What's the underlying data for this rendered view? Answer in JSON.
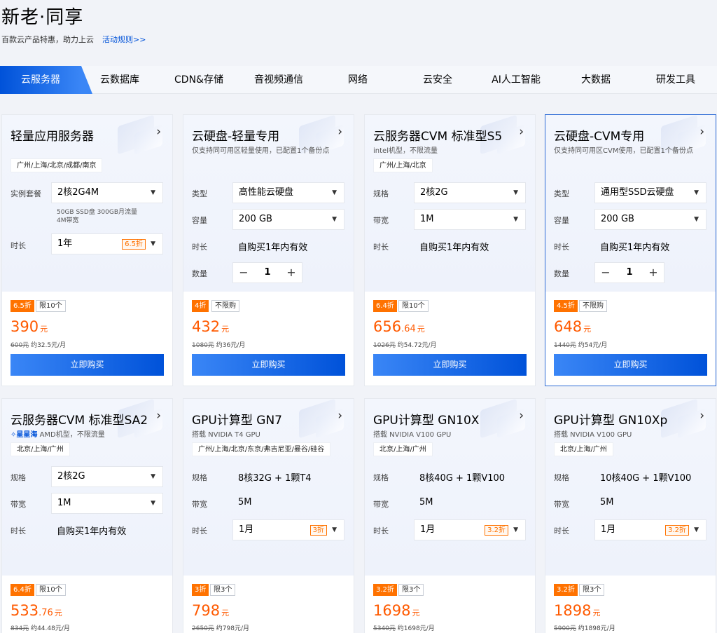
{
  "header": {
    "title": "新老·同享",
    "subtitle": "百款云产品特惠，助力上云",
    "rules_link": "活动规则>>"
  },
  "tabs": [
    "云服务器",
    "云数据库",
    "CDN&存储",
    "音视频通信",
    "网络",
    "云安全",
    "AI人工智能",
    "大数据",
    "研发工具"
  ],
  "cards": [
    {
      "title": "轻量应用服务器",
      "desc": "",
      "region": "广州/上海/北京/成都/南京",
      "label1": "实例套餐",
      "value1": "2核2G4M",
      "note1a": "50GB SSD盘 300GB月流量",
      "note1b": "4M带宽",
      "label2": "时长",
      "value2": "1年",
      "value2_discount": "6.5折",
      "badge": "6.5折",
      "limit": "限10个",
      "price": "390",
      "price_dec": "",
      "unit": "元",
      "orig_price": "600元",
      "per_month": "约32.5元/月",
      "buy": "立即购买"
    },
    {
      "title": "云硬盘-轻量专用",
      "desc": "仅支持同可用区轻量使用，已配置1个备份点",
      "label1": "类型",
      "value1": "高性能云硬盘",
      "label2": "容量",
      "value2": "200 GB",
      "label3": "时长",
      "value3": "自购买1年内有效",
      "label4": "数量",
      "qty": "1",
      "badge": "4折",
      "limit": "不限购",
      "price": "432",
      "price_dec": "",
      "unit": "元",
      "orig_price": "1080元",
      "per_month": "约36元/月",
      "buy": "立即购买"
    },
    {
      "title": "云服务器CVM 标准型S5",
      "desc": "intel机型，不限流量",
      "region": "广州/上海/北京",
      "label1": "规格",
      "value1": "2核2G",
      "label2": "带宽",
      "value2": "1M",
      "label3": "时长",
      "value3": "自购买1年内有效",
      "badge": "6.4折",
      "limit": "限10个",
      "price": "656",
      "price_dec": ".64",
      "unit": "元",
      "orig_price": "1026元",
      "per_month": "约54.72元/月",
      "buy": "立即购买"
    },
    {
      "title": "云硬盘-CVM专用",
      "desc": "仅支持同可用区CVM使用，已配置1个备份点",
      "label1": "类型",
      "value1": "通用型SSD云硬盘",
      "label2": "容量",
      "value2": "200 GB",
      "label3": "时长",
      "value3": "自购买1年内有效",
      "label4": "数量",
      "qty": "1",
      "badge": "4.5折",
      "limit": "不限购",
      "price": "648",
      "price_dec": "",
      "unit": "元",
      "orig_price": "1440元",
      "per_month": "约54元/月",
      "buy": "立即购买"
    },
    {
      "title": "云服务器CVM 标准型SA2",
      "brand": "星星海",
      "desc": "AMD机型，不限流量",
      "region": "北京/上海/广州",
      "label1": "规格",
      "value1": "2核2G",
      "label2": "带宽",
      "value2": "1M",
      "label3": "时长",
      "value3": "自购买1年内有效",
      "badge": "6.4折",
      "limit": "限10个",
      "price": "533",
      "price_dec": ".76",
      "unit": "元",
      "orig_price": "834元",
      "per_month": "约44.48元/月"
    },
    {
      "title": "GPU计算型 GN7",
      "desc": "搭载 NVIDIA T4 GPU",
      "region": "广州/上海/北京/东京/弗吉尼亚/曼谷/硅谷",
      "label1": "规格",
      "value1": "8核32G + 1颗T4",
      "label2": "带宽",
      "value2": "5M",
      "label3": "时长",
      "value3": "1月",
      "value3_discount": "3折",
      "badge": "3折",
      "limit": "限3个",
      "price": "798",
      "price_dec": "",
      "unit": "元",
      "orig_price": "2650元",
      "per_month": "约798元/月"
    },
    {
      "title": "GPU计算型 GN10X",
      "desc": "搭载 NVIDIA V100 GPU",
      "region": "北京/上海/广州",
      "label1": "规格",
      "value1": "8核40G + 1颗V100",
      "label2": "带宽",
      "value2": "5M",
      "label3": "时长",
      "value3": "1月",
      "value3_discount": "3.2折",
      "badge": "3.2折",
      "limit": "限3个",
      "price": "1698",
      "price_dec": "",
      "unit": "元",
      "orig_price": "5340元",
      "per_month": "约1698元/月"
    },
    {
      "title": "GPU计算型 GN10Xp",
      "desc": "搭载 NVIDIA V100 GPU",
      "region": "北京/上海/广州",
      "label1": "规格",
      "value1": "10核40G + 1颗V100",
      "label2": "带宽",
      "value2": "5M",
      "label3": "时长",
      "value3": "1月",
      "value3_discount": "3.2折",
      "badge": "3.2折",
      "limit": "限3个",
      "price": "1898",
      "price_dec": "",
      "unit": "元",
      "orig_price": "5900元",
      "per_month": "约1898元/月"
    }
  ]
}
